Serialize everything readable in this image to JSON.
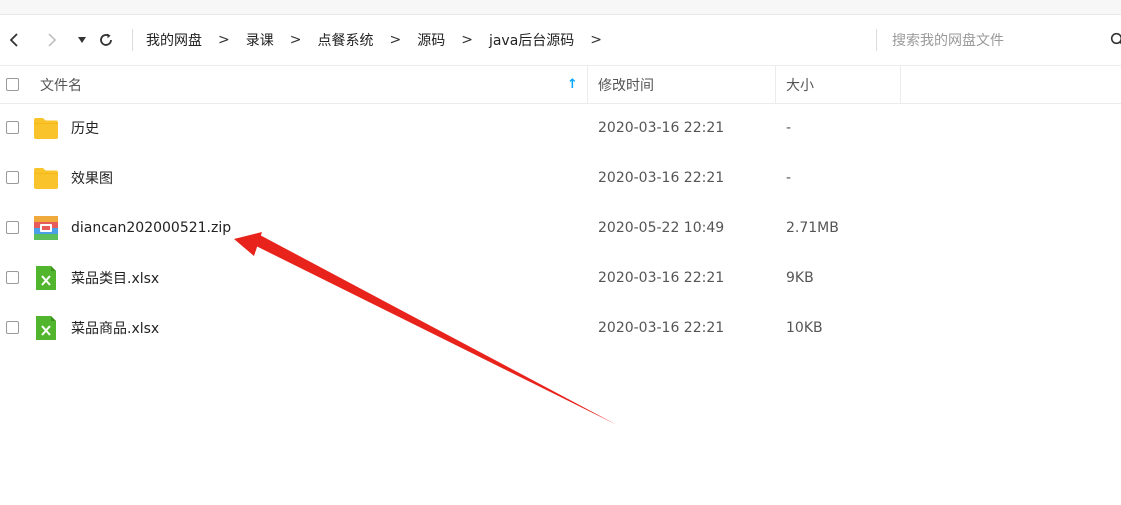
{
  "toolbar": {
    "breadcrumb": [
      "我的网盘",
      "录课",
      "点餐系统",
      "源码",
      "java后台源码"
    ],
    "breadcrumb_separator": ">",
    "search_placeholder": "搜索我的网盘文件"
  },
  "table": {
    "columns": {
      "name": "文件名",
      "modified": "修改时间",
      "size": "大小"
    },
    "sort_indicator": "↑",
    "rows": [
      {
        "name": "历史",
        "modified": "2020-03-16 22:21",
        "size": "-",
        "icon": "folder-icon"
      },
      {
        "name": "效果图",
        "modified": "2020-03-16 22:21",
        "size": "-",
        "icon": "folder-icon"
      },
      {
        "name": "diancan202000521.zip",
        "modified": "2020-05-22 10:49",
        "size": "2.71MB",
        "icon": "zip-file-icon"
      },
      {
        "name": "菜品类目.xlsx",
        "modified": "2020-03-16 22:21",
        "size": "9KB",
        "icon": "excel-file-icon"
      },
      {
        "name": "菜品商品.xlsx",
        "modified": "2020-03-16 22:21",
        "size": "10KB",
        "icon": "excel-file-icon"
      }
    ]
  },
  "colors": {
    "folder": "#f9c32b",
    "excel": "#52b52e",
    "accent": "#06a7ff",
    "annotation_arrow": "#e8231c"
  }
}
